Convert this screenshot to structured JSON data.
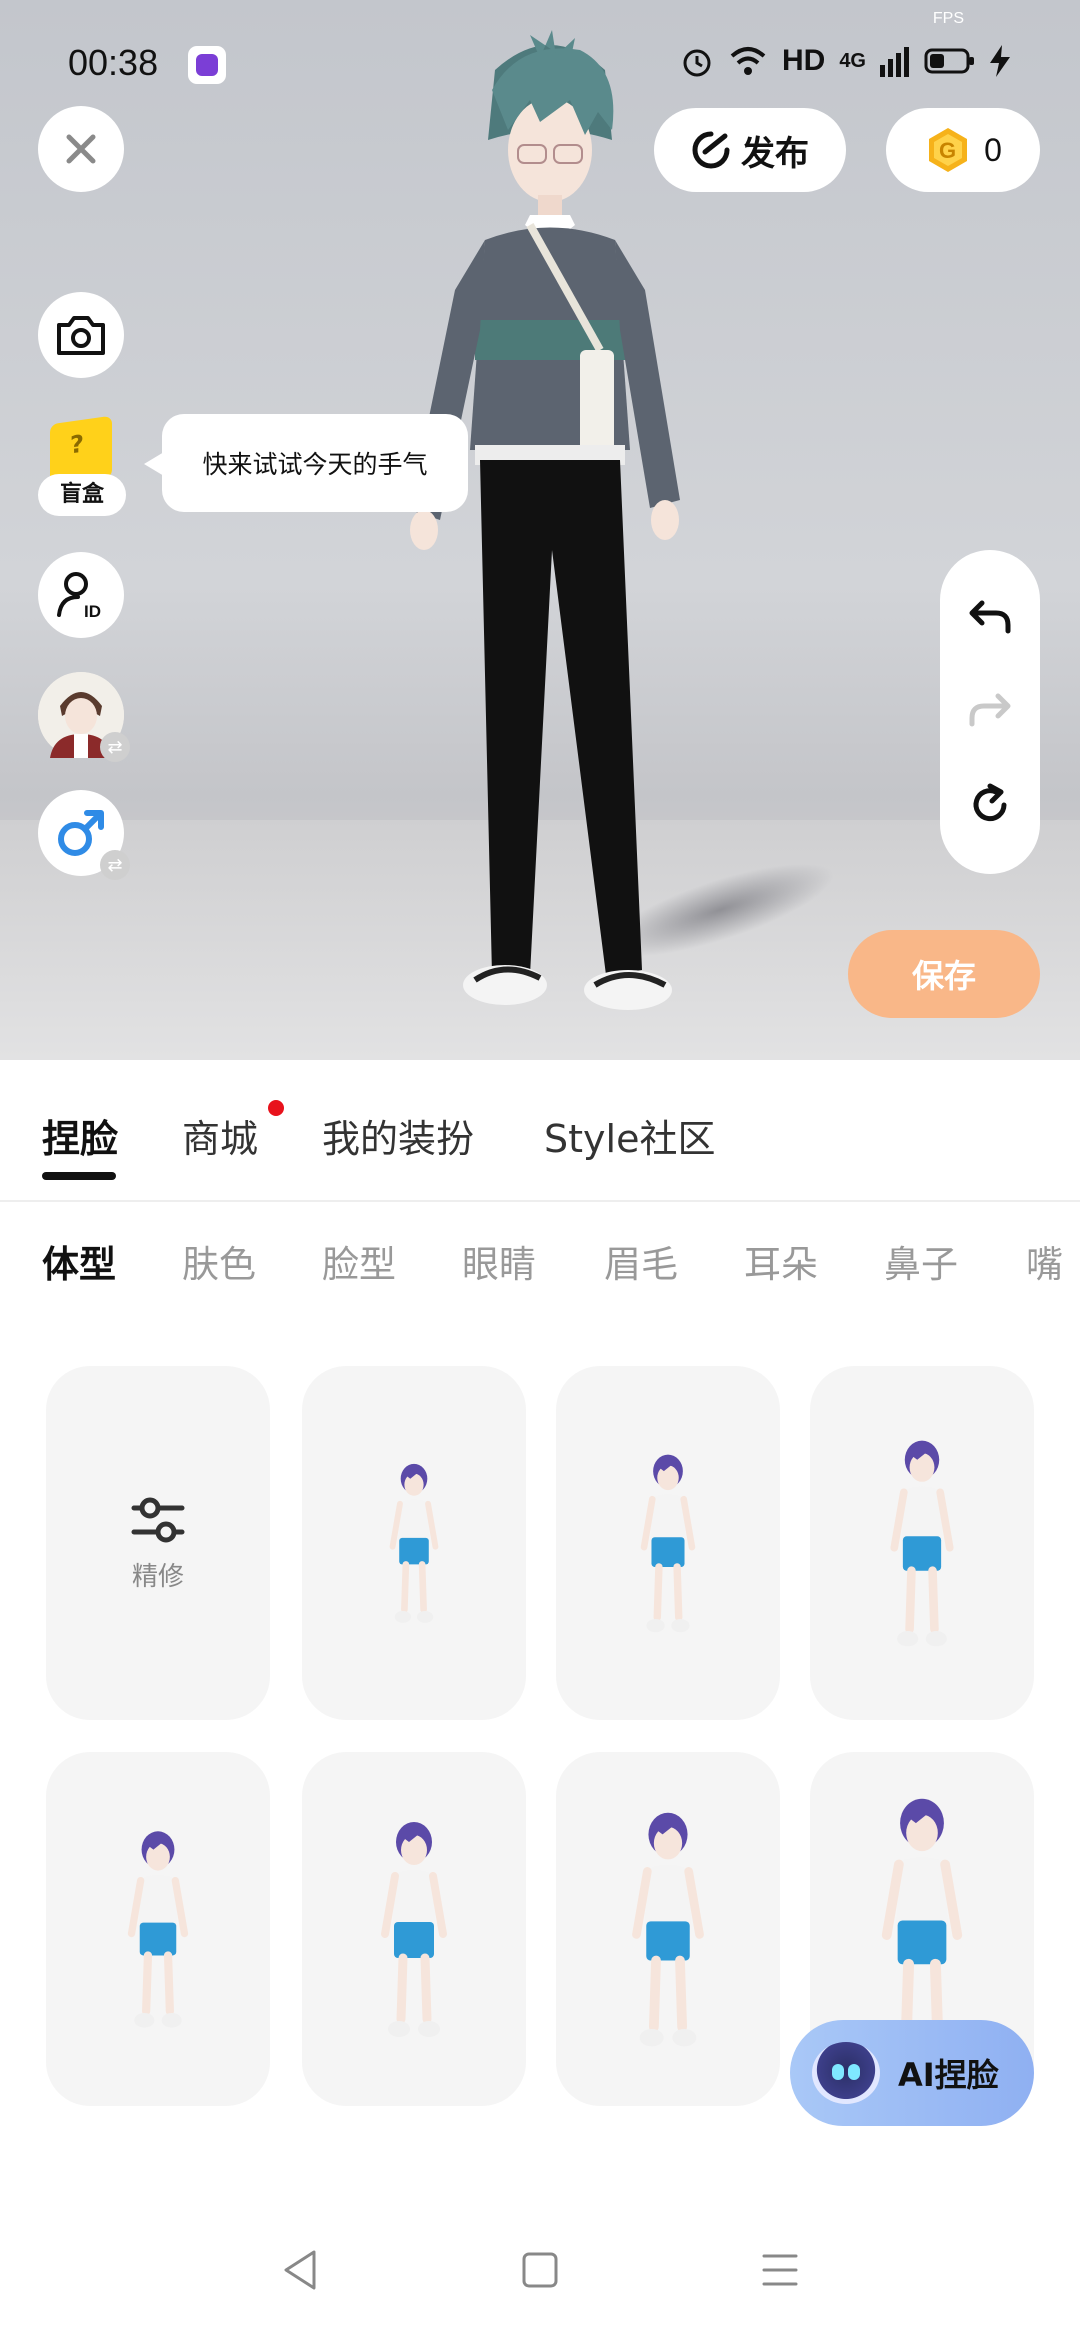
{
  "status_bar": {
    "time": "00:38",
    "fps_label": "FPS",
    "hd_label": "HD",
    "network_label": "4G"
  },
  "top_actions": {
    "publish_label": "发布",
    "coin_count": "0"
  },
  "side_tools": {
    "blind_box_label": "盲盒",
    "tooltip_text": "快来试试今天的手气"
  },
  "save_label": "保存",
  "main_tabs": [
    {
      "label": "捏脸",
      "active": true
    },
    {
      "label": "商城",
      "active": false,
      "has_dot": true
    },
    {
      "label": "我的装扮",
      "active": false
    },
    {
      "label": "Style社区",
      "active": false
    }
  ],
  "sub_tabs": [
    {
      "label": "体型",
      "active": true
    },
    {
      "label": "肤色"
    },
    {
      "label": "脸型"
    },
    {
      "label": "眼睛"
    },
    {
      "label": "眉毛"
    },
    {
      "label": "耳朵"
    },
    {
      "label": "鼻子"
    },
    {
      "label": "嘴"
    }
  ],
  "grid": {
    "refine_label": "精修",
    "body_presets": 7
  },
  "ai_button_label": "AI捏脸",
  "colors": {
    "save_bg": "#f9b788",
    "accent_red": "#e8121c",
    "ai_gradient_start": "#a9c8f7",
    "ai_gradient_end": "#8fb0f2"
  }
}
